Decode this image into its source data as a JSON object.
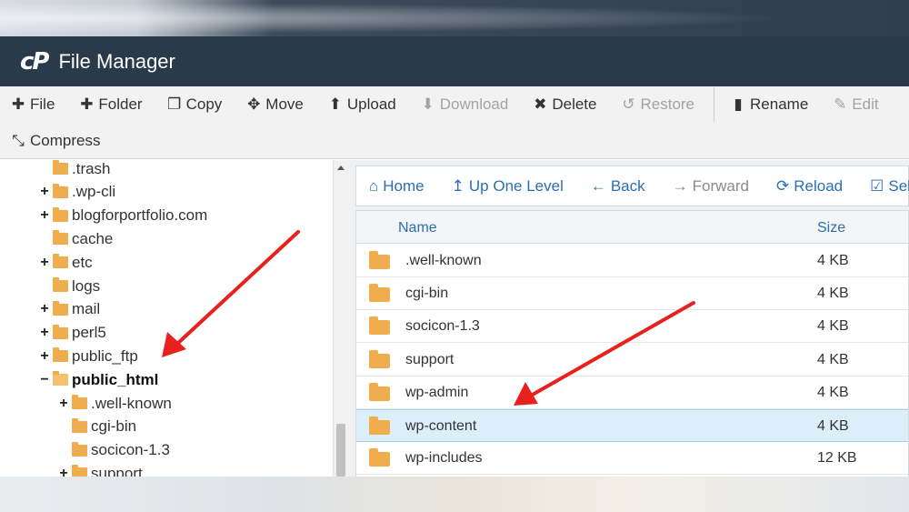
{
  "header": {
    "logo": "cP",
    "title": "File Manager"
  },
  "toolbar": {
    "row1": [
      {
        "icon": "plus-icon",
        "glyph": "✚",
        "label": "File",
        "disabled": false
      },
      {
        "icon": "plus-icon",
        "glyph": "✚",
        "label": "Folder",
        "disabled": false
      },
      {
        "icon": "copy-icon",
        "glyph": "❐",
        "label": "Copy",
        "disabled": false
      },
      {
        "icon": "move-icon",
        "glyph": "✥",
        "label": "Move",
        "disabled": false
      },
      {
        "icon": "upload-icon",
        "glyph": "⬆",
        "label": "Upload",
        "disabled": false
      },
      {
        "icon": "download-icon",
        "glyph": "⬇",
        "label": "Download",
        "disabled": true
      },
      {
        "icon": "delete-icon",
        "glyph": "✖",
        "label": "Delete",
        "disabled": false
      },
      {
        "icon": "restore-icon",
        "glyph": "↺",
        "label": "Restore",
        "disabled": true
      },
      {
        "icon": "rename-icon",
        "glyph": "▮",
        "label": "Rename",
        "disabled": false
      },
      {
        "icon": "edit-icon",
        "glyph": "✎",
        "label": "Edit",
        "disabled": true
      }
    ],
    "row2": [
      {
        "icon": "compress-icon",
        "glyph": "⤡",
        "label": "Compress",
        "disabled": false
      }
    ]
  },
  "tree": [
    {
      "label": ".trash",
      "toggle": "",
      "level": 1,
      "bold": false,
      "open": false
    },
    {
      "label": ".wp-cli",
      "toggle": "+",
      "level": 1,
      "bold": false,
      "open": false
    },
    {
      "label": "blogforportfolio.com",
      "toggle": "+",
      "level": 1,
      "bold": false,
      "open": false
    },
    {
      "label": "cache",
      "toggle": "",
      "level": 1,
      "bold": false,
      "open": false
    },
    {
      "label": "etc",
      "toggle": "+",
      "level": 1,
      "bold": false,
      "open": false
    },
    {
      "label": "logs",
      "toggle": "",
      "level": 1,
      "bold": false,
      "open": false
    },
    {
      "label": "mail",
      "toggle": "+",
      "level": 1,
      "bold": false,
      "open": false
    },
    {
      "label": "perl5",
      "toggle": "+",
      "level": 1,
      "bold": false,
      "open": false
    },
    {
      "label": "public_ftp",
      "toggle": "+",
      "level": 1,
      "bold": false,
      "open": false
    },
    {
      "label": "public_html",
      "toggle": "−",
      "level": 1,
      "bold": true,
      "open": true
    },
    {
      "label": ".well-known",
      "toggle": "+",
      "level": 2,
      "bold": false,
      "open": false
    },
    {
      "label": "cgi-bin",
      "toggle": "",
      "level": 2,
      "bold": false,
      "open": false
    },
    {
      "label": "socicon-1.3",
      "toggle": "",
      "level": 2,
      "bold": false,
      "open": false
    },
    {
      "label": "support",
      "toggle": "+",
      "level": 2,
      "bold": false,
      "open": false
    }
  ],
  "nav": [
    {
      "icon": "home-icon",
      "glyph": "⌂",
      "label": "Home",
      "disabled": false
    },
    {
      "icon": "up-level-icon",
      "glyph": "↥",
      "label": "Up One Level",
      "disabled": false
    },
    {
      "icon": "back-arrow-icon",
      "glyph": "←",
      "label": "Back",
      "disabled": false
    },
    {
      "icon": "forward-arrow-icon",
      "glyph": "→",
      "label": "Forward",
      "disabled": true
    },
    {
      "icon": "reload-icon",
      "glyph": "⟳",
      "label": "Reload",
      "disabled": false
    },
    {
      "icon": "select-all-icon",
      "glyph": "☑",
      "label": "Sele",
      "disabled": false
    }
  ],
  "list": {
    "columns": {
      "name": "Name",
      "size": "Size"
    },
    "rows": [
      {
        "name": ".well-known",
        "size": "4 KB",
        "selected": false
      },
      {
        "name": "cgi-bin",
        "size": "4 KB",
        "selected": false
      },
      {
        "name": "socicon-1.3",
        "size": "4 KB",
        "selected": false
      },
      {
        "name": "support",
        "size": "4 KB",
        "selected": false
      },
      {
        "name": "wp-admin",
        "size": "4 KB",
        "selected": false
      },
      {
        "name": "wp-content",
        "size": "4 KB",
        "selected": true
      },
      {
        "name": "wp-includes",
        "size": "12 KB",
        "selected": false
      }
    ]
  },
  "colors": {
    "header_bg": "#293a4a",
    "folder": "#f0ad4e",
    "link_blue": "#2a6fb2",
    "selected_row": "#dceefa",
    "annotation_arrow": "#e8211e"
  }
}
